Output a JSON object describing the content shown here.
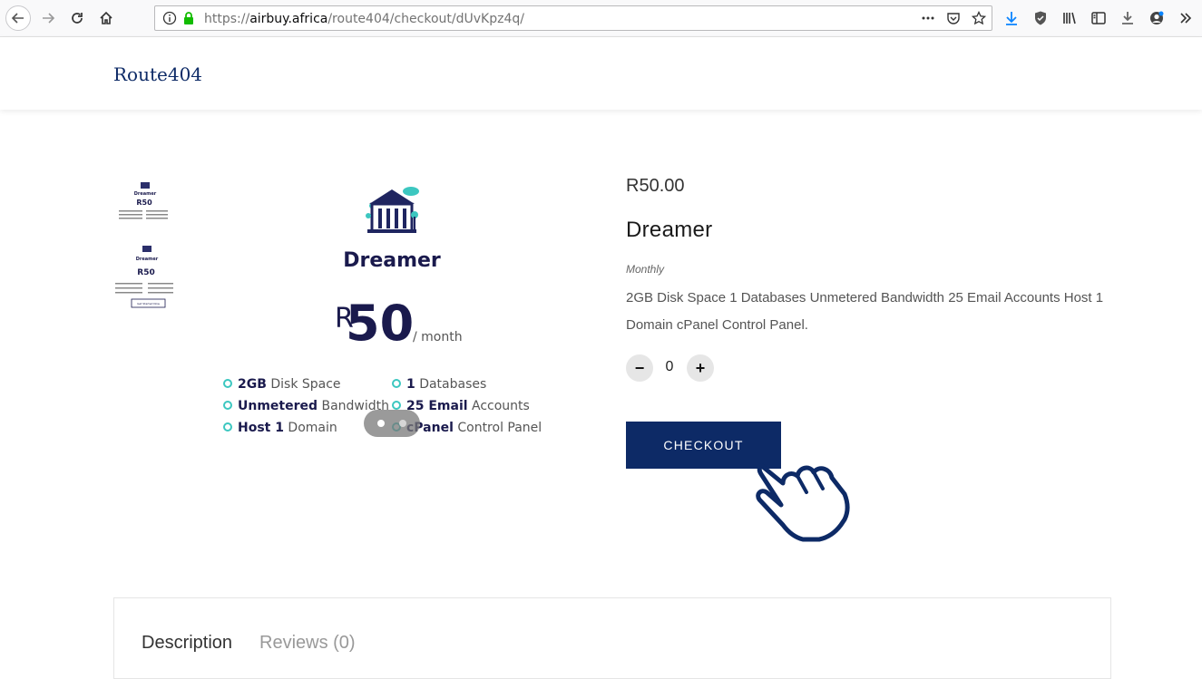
{
  "browser": {
    "url_prefix": "https://",
    "url_host": "airbuy.africa",
    "url_path": "/route404/checkout/dUvKpz4q/"
  },
  "site": {
    "title": "Route404"
  },
  "gallery": {
    "banner": {
      "plan_name": "Dreamer",
      "currency": "R",
      "amount": "50",
      "period": "/ month",
      "features": [
        {
          "bold": "2GB",
          "text": " Disk Space"
        },
        {
          "bold": "1",
          "text": " Databases"
        },
        {
          "bold": "Unmetered",
          "text": " Bandwidth"
        },
        {
          "bold": "25 Email",
          "text": " Accounts"
        },
        {
          "bold": "Host 1",
          "text": " Domain"
        },
        {
          "bold": "cPanel",
          "text": " Control Panel"
        }
      ]
    },
    "thumbnail_button": "Get Started Now"
  },
  "product": {
    "price": "R50.00",
    "name": "Dreamer",
    "billing": "Monthly",
    "description": "2GB Disk Space 1 Databases Unmetered Bandwidth 25 Email Accounts Host 1 Domain cPanel Control Panel.",
    "quantity": "0",
    "minus": "−",
    "plus": "+",
    "checkout_label": "CHECKOUT"
  },
  "tabs": [
    {
      "label": "Description"
    },
    {
      "label": "Reviews (0)"
    }
  ],
  "colors": {
    "brand": "#0d2a66",
    "accent": "#3cc7c0"
  }
}
